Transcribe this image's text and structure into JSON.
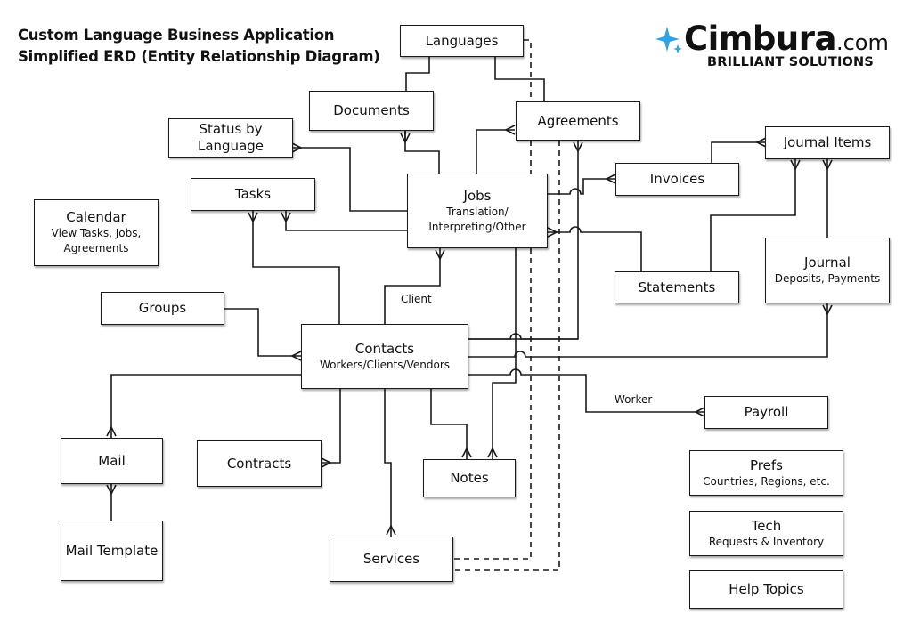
{
  "title": {
    "line1": "Custom Language Business Application",
    "line2": "Simplified ERD (Entity Relationship Diagram)"
  },
  "logo": {
    "icon": "four-point-star-icon",
    "name": "Cimbura",
    "domain": ".com",
    "tagline": "BRILLIANT SOLUTIONS",
    "accent_color": "#2ea3e0"
  },
  "entities": {
    "languages": {
      "name": "Languages"
    },
    "documents": {
      "name": "Documents"
    },
    "agreements": {
      "name": "Agreements"
    },
    "status_by_language": {
      "name": "Status by Language"
    },
    "tasks": {
      "name": "Tasks"
    },
    "jobs": {
      "name": "Jobs",
      "sub": "Translation/ Interpreting/Other"
    },
    "invoices": {
      "name": "Invoices"
    },
    "journal_items": {
      "name": "Journal Items"
    },
    "calendar": {
      "name": "Calendar",
      "sub": "View Tasks, Jobs, Agreements"
    },
    "statements": {
      "name": "Statements"
    },
    "journal": {
      "name": "Journal",
      "sub": "Deposits, Payments"
    },
    "groups": {
      "name": "Groups"
    },
    "contacts": {
      "name": "Contacts",
      "sub": "Workers/Clients/Vendors"
    },
    "payroll": {
      "name": "Payroll"
    },
    "mail": {
      "name": "Mail"
    },
    "contracts": {
      "name": "Contracts"
    },
    "notes": {
      "name": "Notes"
    },
    "prefs": {
      "name": "Prefs",
      "sub": "Countries, Regions, etc."
    },
    "tech": {
      "name": "Tech",
      "sub": "Requests & Inventory"
    },
    "mail_template": {
      "name": "Mail Template"
    },
    "services": {
      "name": "Services"
    },
    "help_topics": {
      "name": "Help Topics"
    }
  },
  "relationship_labels": {
    "client": "Client",
    "worker": "Worker"
  },
  "relationships": [
    {
      "from": "Languages",
      "to": "Documents",
      "type": "one-to-one"
    },
    {
      "from": "Languages",
      "to": "Agreements",
      "type": "one-to-one"
    },
    {
      "from": "Languages",
      "to": "Services",
      "type": "dashed"
    },
    {
      "from": "Documents",
      "to": "Jobs",
      "type": "many-to-one"
    },
    {
      "from": "Agreements",
      "to": "Jobs",
      "type": "many-to-one"
    },
    {
      "from": "Agreements",
      "to": "Contacts",
      "type": "many-to-one"
    },
    {
      "from": "Agreements",
      "to": "Services",
      "type": "dashed"
    },
    {
      "from": "Status by Language",
      "to": "Jobs",
      "type": "many-to-one"
    },
    {
      "from": "Tasks",
      "to": "Jobs",
      "type": "many-to-one"
    },
    {
      "from": "Tasks",
      "to": "Contacts",
      "type": "many-to-one"
    },
    {
      "from": "Jobs",
      "to": "Invoices",
      "type": "many-to-one"
    },
    {
      "from": "Jobs",
      "to": "Statements",
      "type": "many-to-one"
    },
    {
      "from": "Jobs",
      "to": "Contacts",
      "type": "many-to-one",
      "label": "Client"
    },
    {
      "from": "Jobs",
      "to": "Notes",
      "type": "many-to-one"
    },
    {
      "from": "Invoices",
      "to": "Journal Items",
      "type": "many-to-one"
    },
    {
      "from": "Statements",
      "to": "Journal Items",
      "type": "many-to-one"
    },
    {
      "from": "Journal",
      "to": "Journal Items",
      "type": "many-to-one"
    },
    {
      "from": "Journal",
      "to": "Contacts",
      "type": "many-to-one"
    },
    {
      "from": "Groups",
      "to": "Contacts",
      "type": "many-to-one"
    },
    {
      "from": "Contacts",
      "to": "Payroll",
      "type": "many-to-one",
      "label": "Worker"
    },
    {
      "from": "Contacts",
      "to": "Mail",
      "type": "many-to-one"
    },
    {
      "from": "Contacts",
      "to": "Contracts",
      "type": "many-to-one"
    },
    {
      "from": "Contacts",
      "to": "Services",
      "type": "many-to-one"
    },
    {
      "from": "Contacts",
      "to": "Notes",
      "type": "many-to-one"
    },
    {
      "from": "Mail",
      "to": "Mail Template",
      "type": "many-to-one"
    }
  ]
}
